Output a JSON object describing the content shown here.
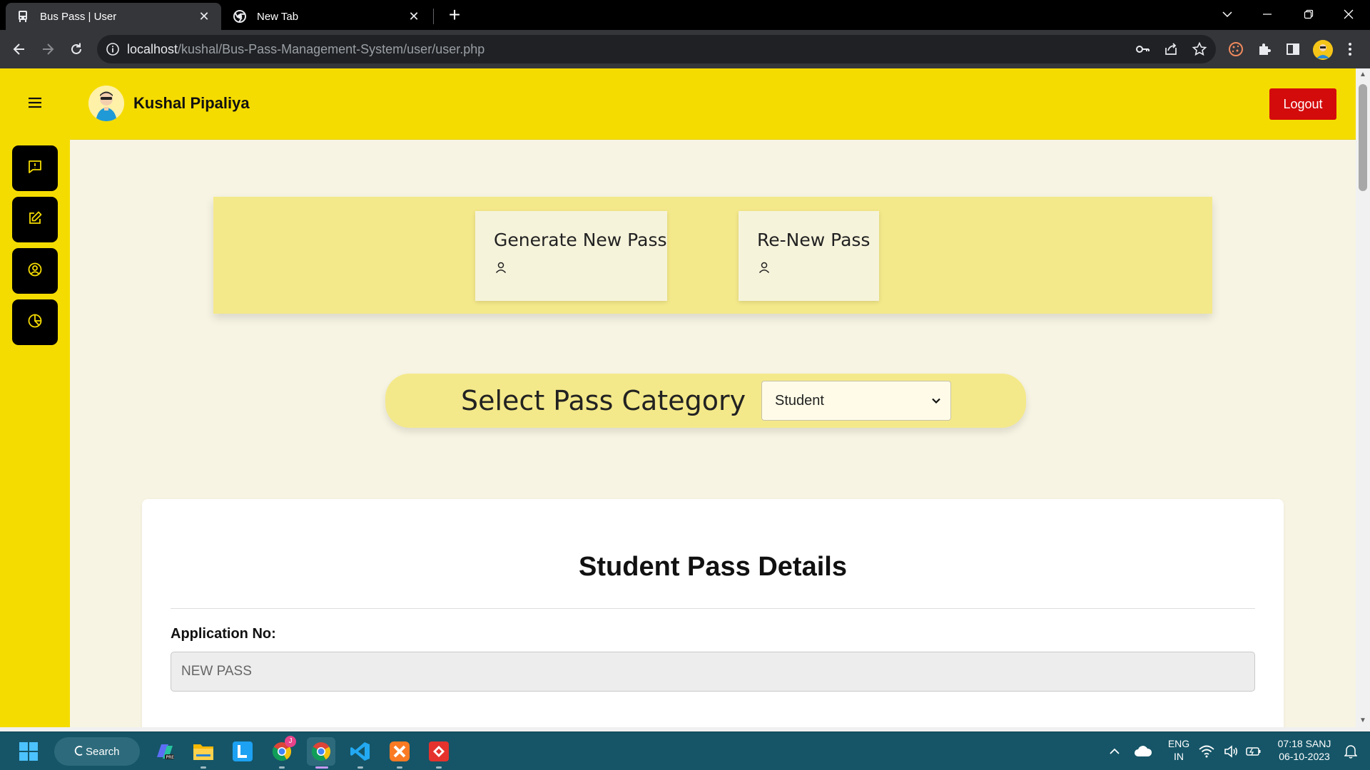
{
  "browser": {
    "tabs": [
      {
        "title": "Bus Pass | User",
        "active": true,
        "icon": "bus-icon"
      },
      {
        "title": "New Tab",
        "active": false,
        "icon": "chrome-icon"
      }
    ],
    "url_host": "localhost",
    "url_path": "/kushal/Bus-Pass-Management-System/user/user.php"
  },
  "header": {
    "user_name": "Kushal Pipaliya",
    "logout_label": "Logout"
  },
  "sidebar": {
    "items": [
      {
        "icon": "message-icon"
      },
      {
        "icon": "edit-icon"
      },
      {
        "icon": "user-circle-icon"
      },
      {
        "icon": "pie-chart-icon"
      }
    ]
  },
  "actions": {
    "generate_label": "Generate New Pass",
    "renew_label": "Re-New Pass"
  },
  "category": {
    "label": "Select Pass Category",
    "selected": "Student"
  },
  "form": {
    "heading": "Student Pass Details",
    "application_label": "Application No:",
    "application_value": "NEW PASS"
  },
  "taskbar": {
    "search_label": "Search",
    "language": "ENG",
    "region": "IN",
    "time": "07:18 SANJ",
    "date": "06-10-2023",
    "chrome_badge": "J"
  },
  "colors": {
    "brand_yellow": "#f5dc00",
    "logout_red": "#d40b0b",
    "page_bg": "#f7f4e3"
  }
}
